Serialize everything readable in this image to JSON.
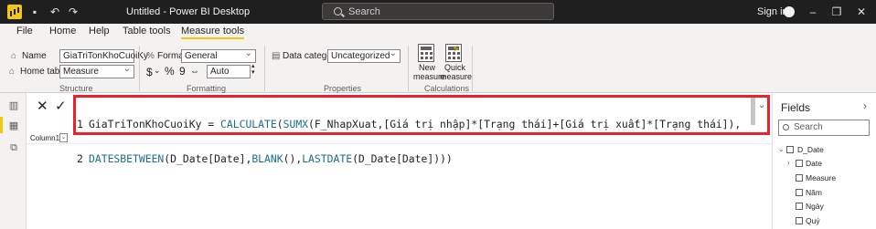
{
  "titlebar": {
    "title": "Untitled - Power BI Desktop",
    "search_placeholder": "Search",
    "signin": "Sign in"
  },
  "tabs": [
    "File",
    "Home",
    "Help",
    "Table tools",
    "Measure tools"
  ],
  "active_tab": "Measure tools",
  "ribbon": {
    "structure": {
      "name_label": "Name",
      "name_value": "GiaTriTonKhoCuoiKy",
      "home_table_label": "Home table",
      "home_table_value": "Measure",
      "group_label": "Structure"
    },
    "formatting": {
      "format_label": "Format",
      "format_value": "General",
      "currency_symbol": "$",
      "percent_symbol": "%",
      "comma_symbol": "9",
      "decimals_value": "Auto",
      "group_label": "Formatting"
    },
    "properties": {
      "data_category_label": "Data category",
      "data_category_value": "Uncategorized",
      "group_label": "Properties"
    },
    "calculations": {
      "new_measure_line1": "New",
      "new_measure_line2": "measure",
      "quick_measure_line1": "Quick",
      "quick_measure_line2": "measure",
      "group_label": "Calculations"
    }
  },
  "formula_bar": {
    "line1_number": "1",
    "line1_measure": "GiaTriTonKhoCuoiKy = ",
    "line1_calculate": "CALCULATE",
    "line1_open": "(",
    "line1_sumx": "SUMX",
    "line1_rest": "(F_NhapXuat,[Giá trị nhập]*[Trạng thái]+[Giá trị xuất]*[Trạng thái]),",
    "line2_number": "2",
    "line2_datesbetween": "DATESBETWEEN",
    "line2_a": "(D_Date[Date],",
    "line2_blank": "BLANK",
    "line2_b": "(),",
    "line2_lastdate": "LASTDATE",
    "line2_c": "(D_Date[Date])))"
  },
  "grid": {
    "column_header": "Column1"
  },
  "fields_pane": {
    "title": "Fields",
    "search_placeholder": "Search",
    "table_name": "D_Date",
    "items": [
      "Date",
      "Measure",
      "Năm",
      "Ngày",
      "Quý"
    ]
  },
  "colors": {
    "titlebar_bg": "#1f1f1f",
    "accent_yellow": "#f2c811",
    "highlight_red": "#e8232b",
    "dax_function": "#1e6c8c"
  }
}
